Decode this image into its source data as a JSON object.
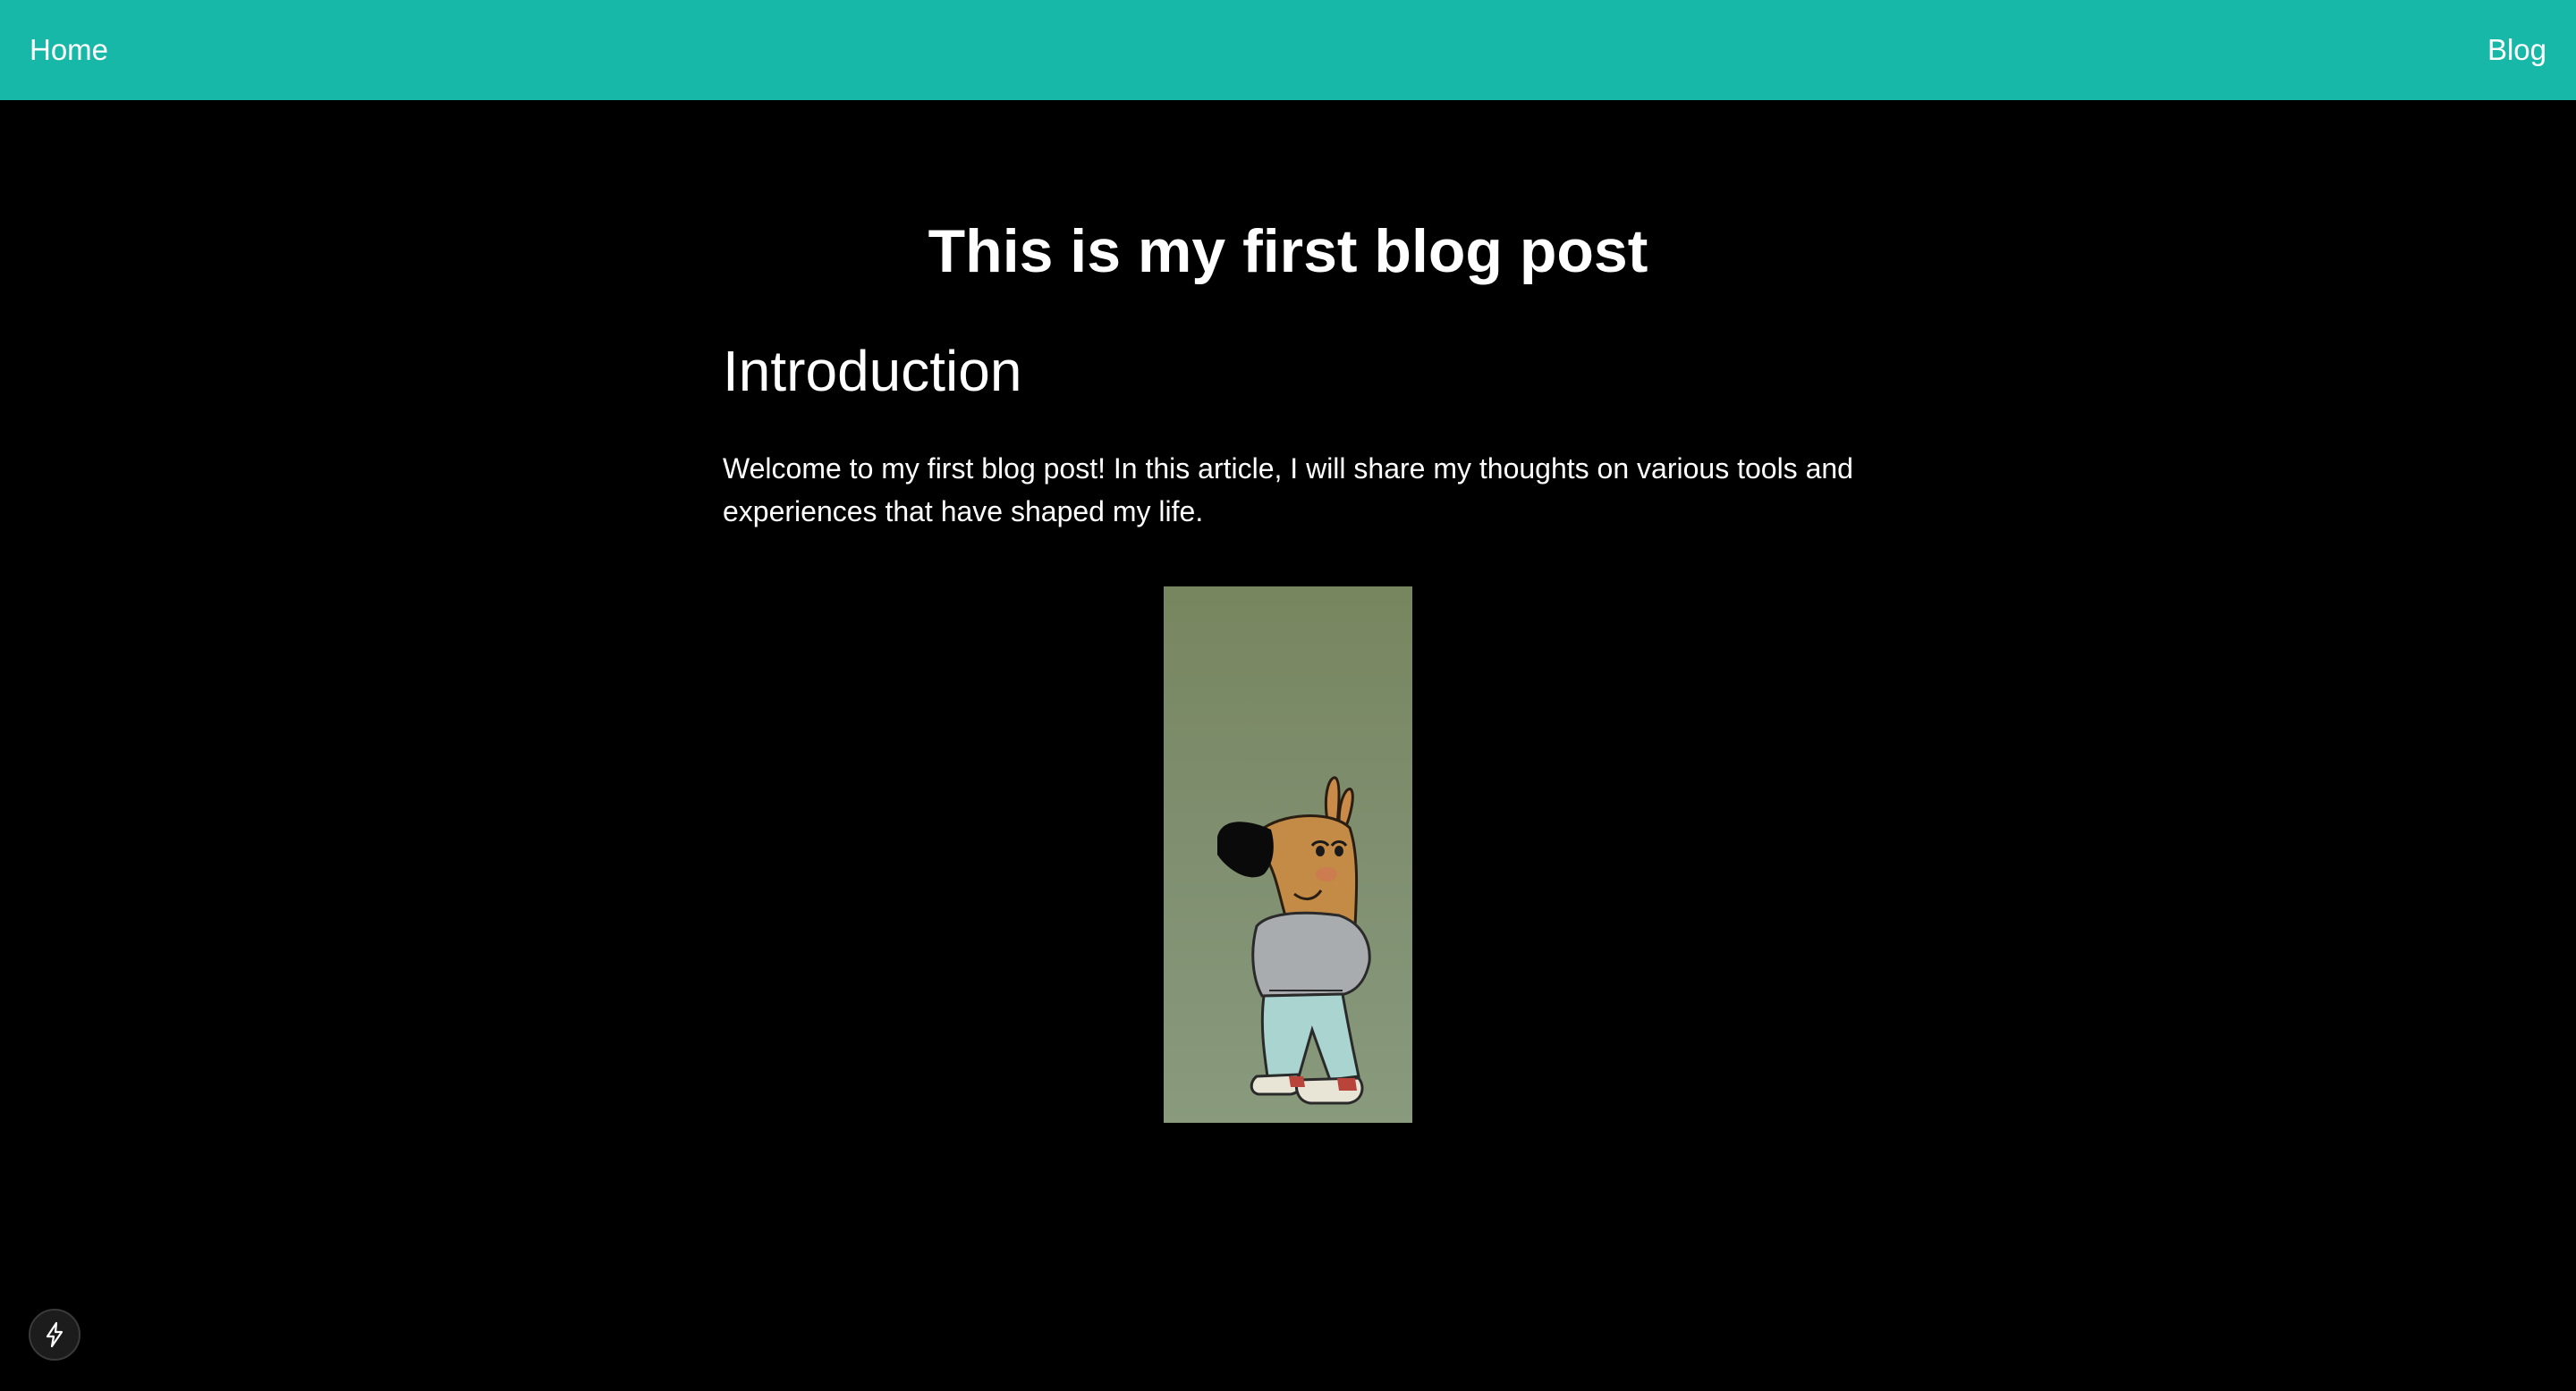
{
  "nav": {
    "home_label": "Home",
    "blog_label": "Blog"
  },
  "post": {
    "title": "This is my first blog post",
    "section_heading": "Introduction",
    "paragraph": "Welcome to my first blog post! In this article, I will share my thoughts on various tools and experiences that have shaped my life."
  },
  "colors": {
    "navbar": "#17b8a8",
    "page_background": "#000000",
    "text": "#ffffff"
  },
  "icons": {
    "floating_button": "lightning-bolt-icon"
  }
}
